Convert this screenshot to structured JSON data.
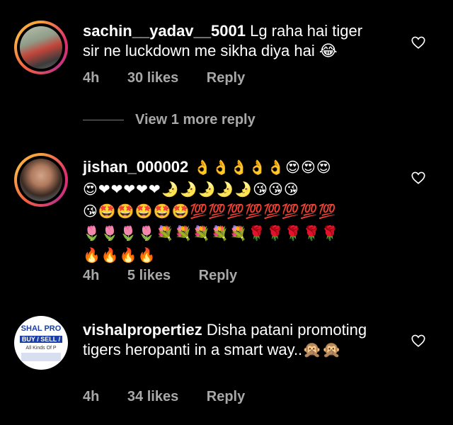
{
  "comments": [
    {
      "username": "sachin__yadav__5001",
      "text": " Lg raha hai tiger sir ne luckdown me sikha diya hai 😂",
      "time": "4h",
      "likes": "30 likes",
      "reply": "Reply"
    },
    {
      "username": "jishan_000002",
      "emoji_lines": [
        " 👌👌👌👌👌😍😍😍",
        "😍❤❤❤❤❤🌛🌛🌛🌛🌛😘😘😘",
        "😘🤩🤩🤩🤩🤩💯💯💯💯💯💯💯💯",
        "🌷🌷🌷🌷💐💐💐💐💐🌹🌹🌹🌹🌹",
        "🔥🔥🔥🔥"
      ],
      "time": "4h",
      "likes": "5 likes",
      "reply": "Reply"
    },
    {
      "username": "vishalpropertiez",
      "text": " Disha patani promoting tigers heropanti in a smart way..🙊🙊",
      "time": "4h",
      "likes": "34 likes",
      "reply": "Reply",
      "logo": {
        "top": "SHAL PRO",
        "mid": "BUY / SELL /",
        "bot": "All Kinds Of P"
      }
    }
  ],
  "view_more": "View 1 more reply",
  "colors": {
    "background": "#000000",
    "meta": "#a8a8a8",
    "text": "#ffffff"
  },
  "icons": {
    "like": "heart-outline-icon"
  }
}
